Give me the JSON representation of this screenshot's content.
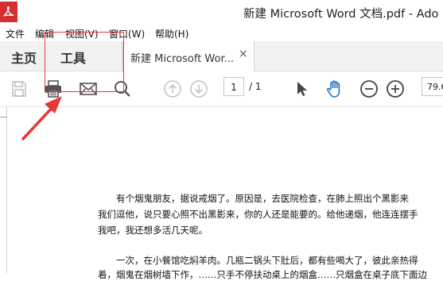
{
  "window": {
    "title": "新建 Microsoft Word 文档.pdf - Ado"
  },
  "menu": {
    "items": [
      "文件",
      "编辑",
      "视图(V)",
      "窗口(W)",
      "帮助(H)"
    ]
  },
  "tabs": {
    "home": "主页",
    "tools": "工具",
    "document": "新建 Microsoft Wor...",
    "close": "×"
  },
  "toolbar": {
    "icons": [
      "save-icon",
      "print-icon",
      "mail-icon",
      "search-icon",
      "page-up-icon",
      "page-down-icon",
      "select-arrow-icon",
      "hand-icon",
      "zoom-out-icon",
      "zoom-in-icon"
    ],
    "page_current": "1",
    "page_total": "/ 1",
    "zoom": "79.6"
  },
  "document": {
    "lines": [
      "有个烟鬼朋友，据说戒烟了。原因是，去医院检查，在肺上照出个黑影来",
      "我们逗他，说只要心照不出黑影来，你的人还是能要的。给他递烟，他连连摆手",
      "我吧，我还想多活几天呢。",
      "一次，在小餐馆吃焖羊肉。几瓶二锅头下肚后，都有些喝大了，彼此亲热得",
      "着，烟鬼在烟树墙下作，……只手不停扶动桌上的烟盒……只烟盒在桌子底下面边"
    ]
  },
  "colors": {
    "annotation": "#e53935",
    "app_red": "#d32f2f",
    "hand_blue": "#1e73be"
  }
}
